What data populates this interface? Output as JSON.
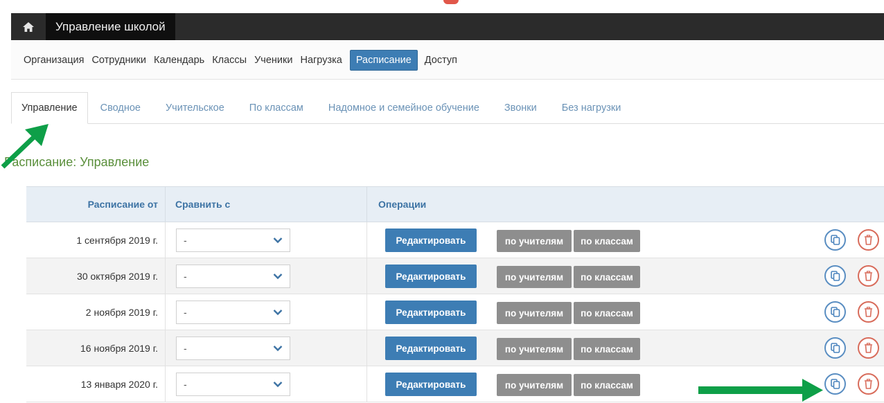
{
  "app": {
    "title": "Управление школой"
  },
  "main_nav": [
    "Организация",
    "Сотрудники",
    "Календарь",
    "Классы",
    "Ученики",
    "Нагрузка",
    "Расписание",
    "Доступ"
  ],
  "main_nav_active": "Расписание",
  "tabs": [
    "Управление",
    "Сводное",
    "Учительское",
    "По классам",
    "Надомное и семейное обучение",
    "Звонки",
    "Без нагрузки"
  ],
  "tabs_active": "Управление",
  "page": {
    "title": "Расписание: Управление"
  },
  "table": {
    "headers": {
      "schedule_from": "Расписание от",
      "compare_with": "Сравнить с",
      "operations": "Операции"
    },
    "rows": [
      {
        "date": "1 сентября 2019 г.",
        "compare": "-"
      },
      {
        "date": "30 октября 2019 г.",
        "compare": "-"
      },
      {
        "date": "2 ноября 2019 г.",
        "compare": "-"
      },
      {
        "date": "16 ноября 2019 г.",
        "compare": "-"
      },
      {
        "date": "13 января 2020 г.",
        "compare": "-"
      }
    ],
    "buttons": {
      "edit": "Редактировать",
      "by_teachers": "по учителям",
      "by_classes": "по классам"
    }
  },
  "colors": {
    "accent": "#3d7db4",
    "topbar": "#2b2b2b",
    "title_green": "#5a8f3b",
    "arrow_green": "#0e9f48",
    "delete_red": "#d86c5b"
  },
  "icons": {
    "home": "home-icon",
    "copy": "copy-icon",
    "delete": "trash-icon",
    "dropdown": "chevron-down-icon"
  }
}
